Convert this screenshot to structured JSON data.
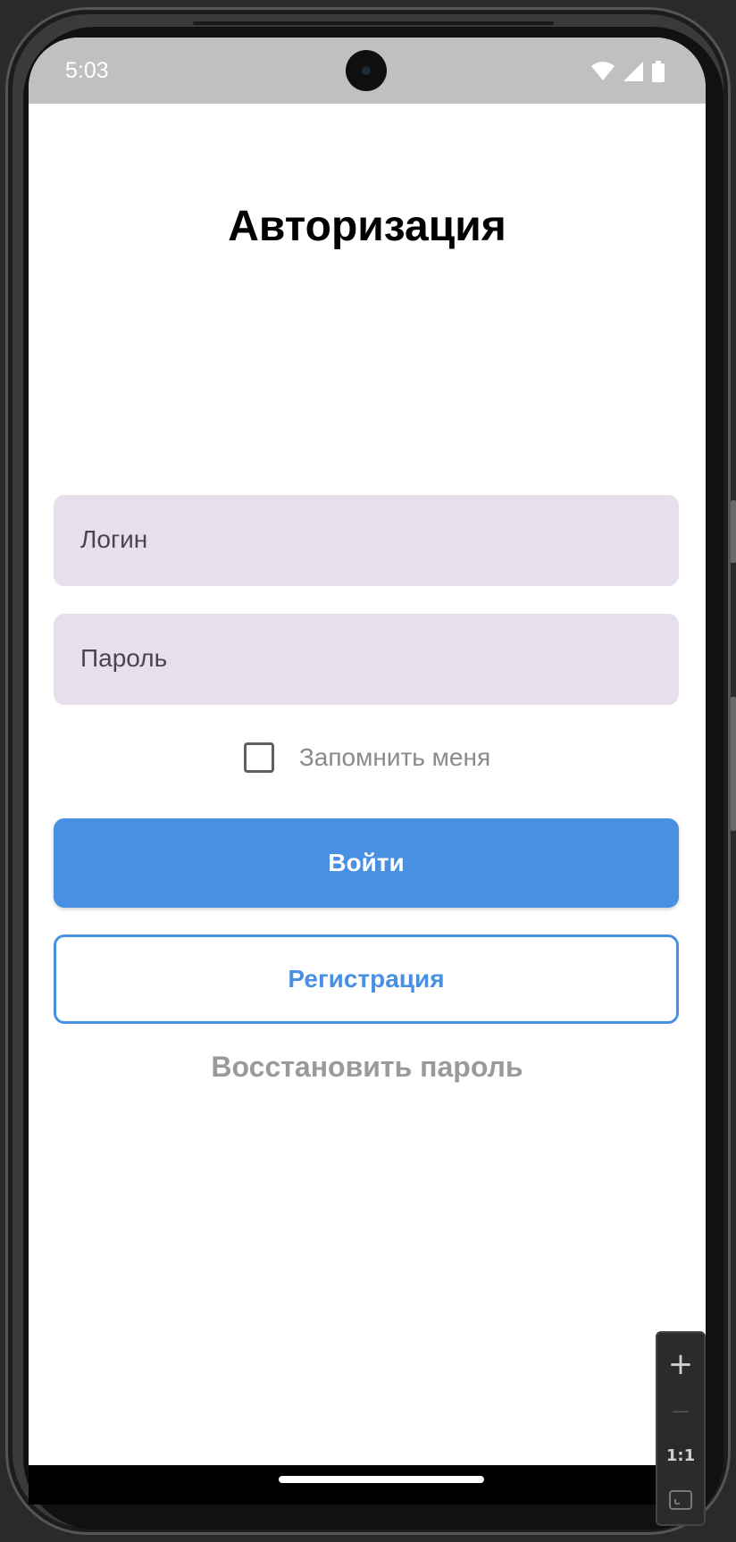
{
  "status_bar": {
    "time": "5:03",
    "icons": [
      "wifi-icon",
      "signal-icon",
      "battery-icon"
    ]
  },
  "page": {
    "title": "Авторизация"
  },
  "form": {
    "login_placeholder": "Логин",
    "password_placeholder": "Пароль",
    "remember_label": "Запомнить меня",
    "remember_checked": false,
    "login_button": "Войти",
    "register_button": "Регистрация",
    "restore_link": "Восстановить пароль"
  },
  "zoom_controls": {
    "zoom_in": "+",
    "zoom_out": "—",
    "actual_size": "1:1"
  },
  "colors": {
    "primary": "#4a90e2",
    "input_bg": "#e7e0ec",
    "status_bar_bg": "#c0c0c0"
  }
}
